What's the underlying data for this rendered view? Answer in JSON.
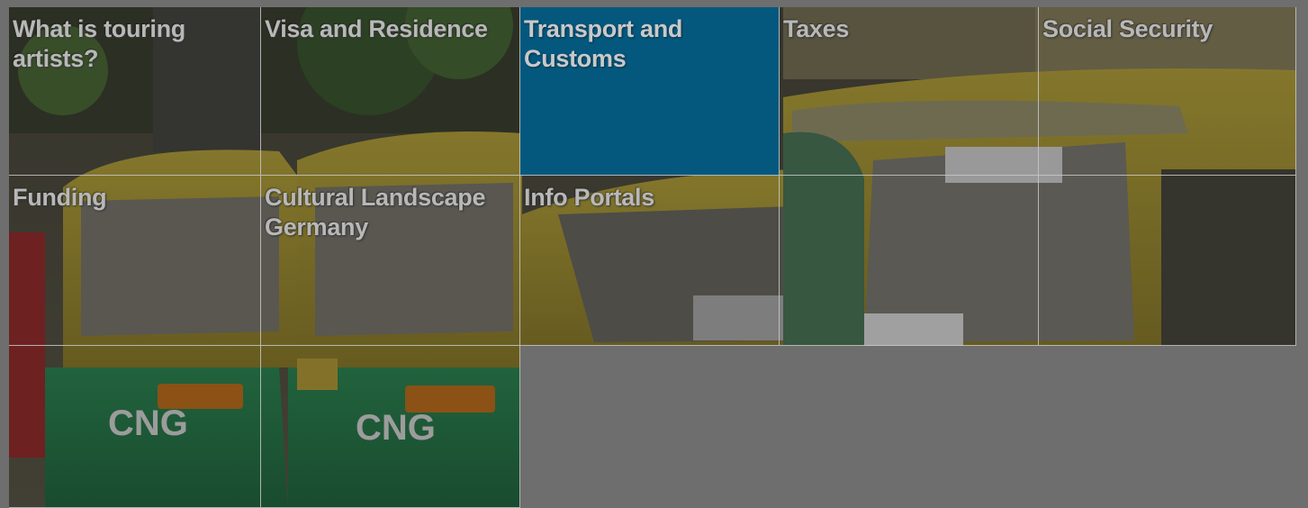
{
  "tiles": [
    {
      "label": "What is touring artists?"
    },
    {
      "label": "Visa and Residence"
    },
    {
      "label": "Transport and Customs",
      "active": true
    },
    {
      "label": "Taxes"
    },
    {
      "label": "Social Security"
    },
    {
      "label": "Funding"
    },
    {
      "label": "Cultural Landscape Germany"
    },
    {
      "label": "Info Portals"
    },
    {
      "label": ""
    },
    {
      "label": ""
    },
    {
      "label": ""
    },
    {
      "label": ""
    }
  ],
  "colors": {
    "active_tile": "#04587e",
    "overlay_grey": "#6e6e6e"
  }
}
